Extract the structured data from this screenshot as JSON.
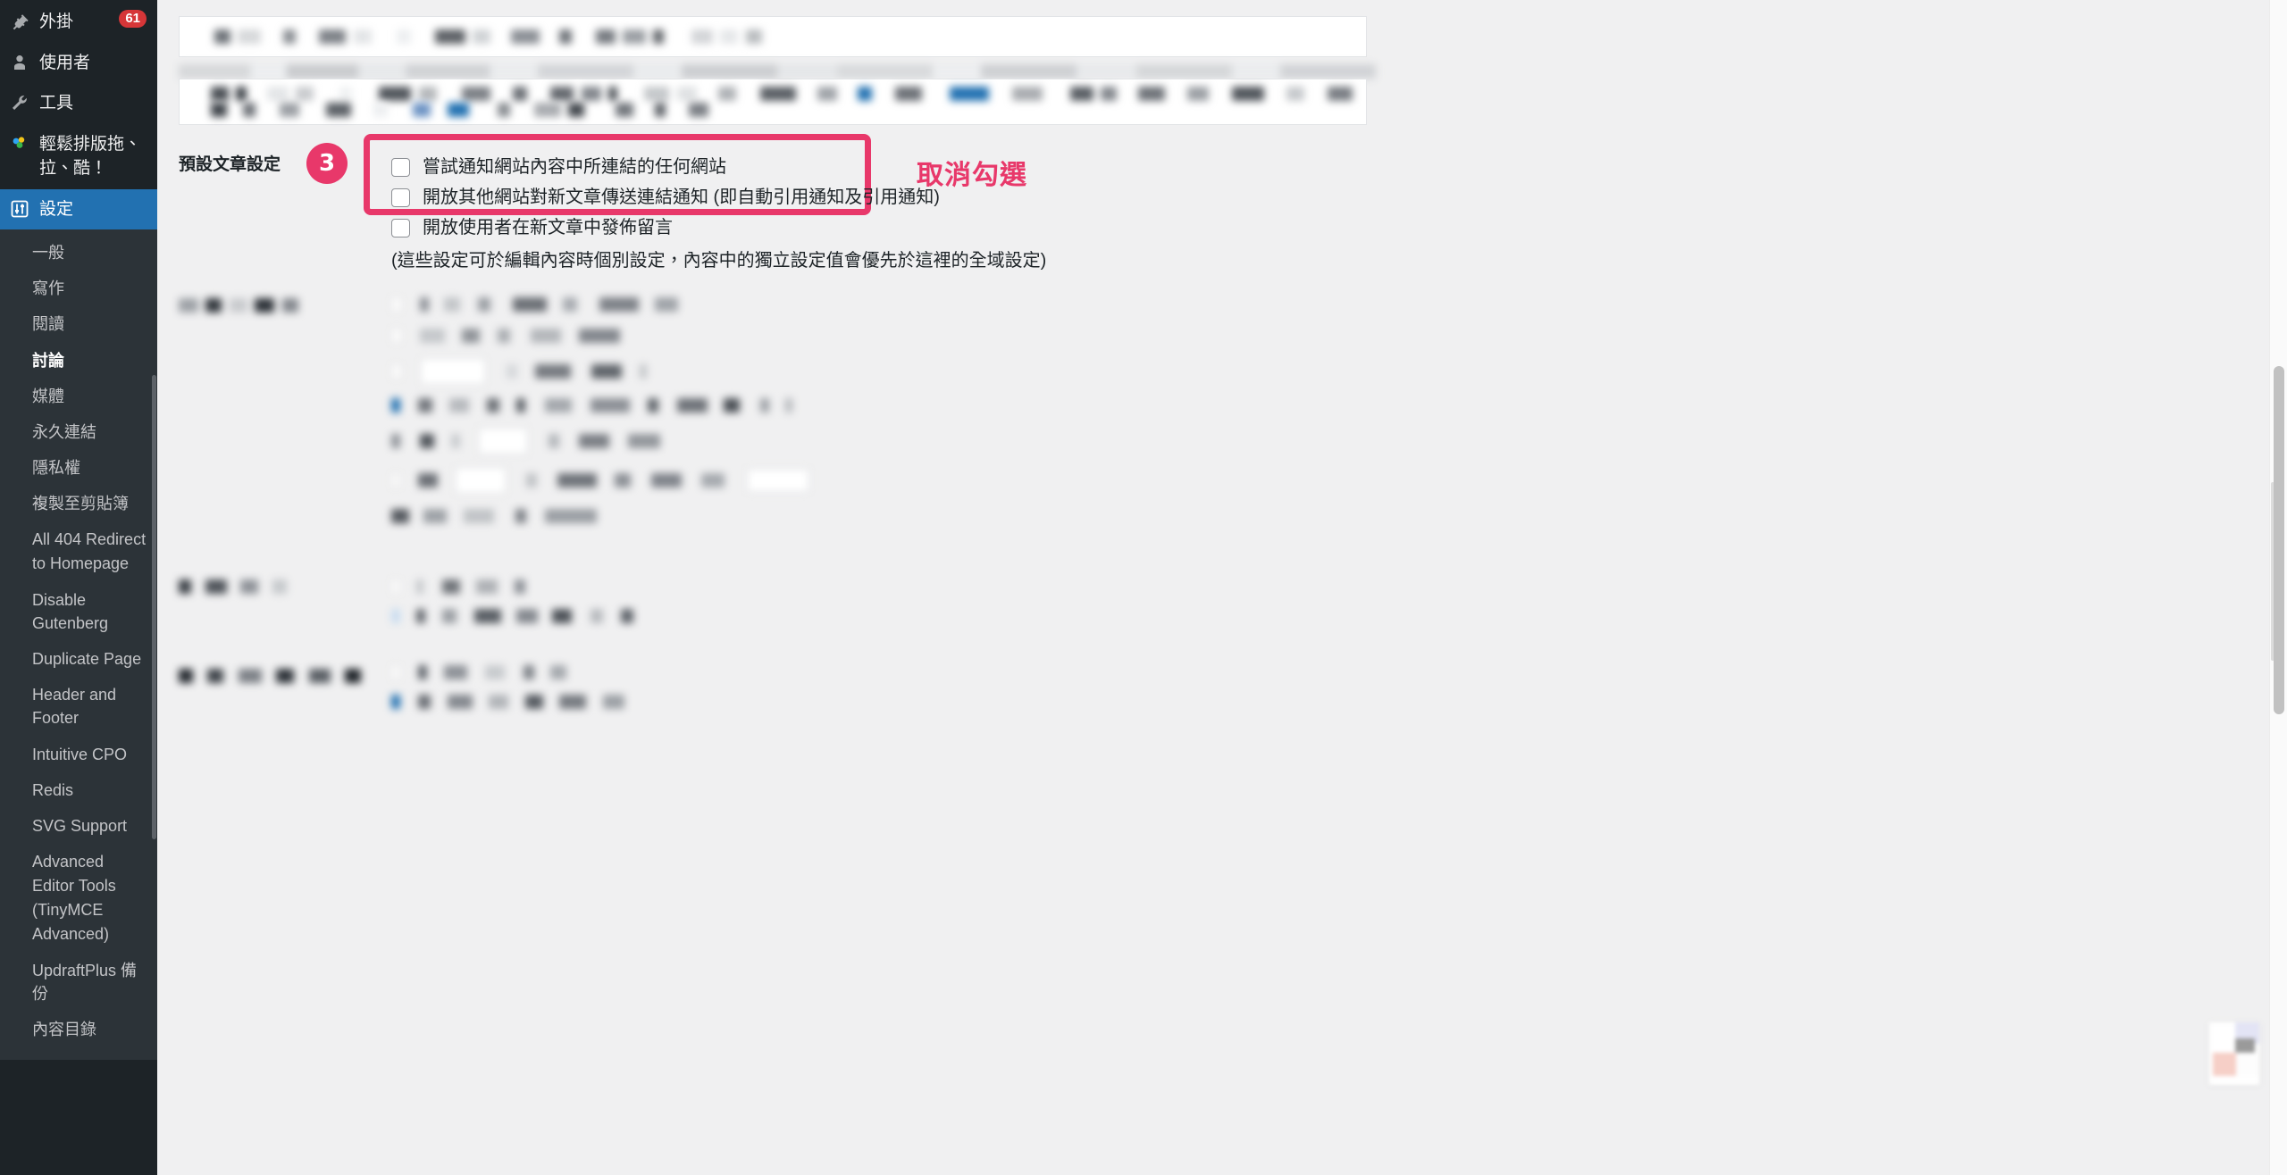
{
  "sidebar": {
    "menu": [
      {
        "label": "外掛",
        "icon": "plug-icon",
        "badge": "61",
        "current": false
      },
      {
        "label": "使用者",
        "icon": "user-icon",
        "badge": "",
        "current": false
      },
      {
        "label": "工具",
        "icon": "wrench-icon",
        "badge": "",
        "current": false
      },
      {
        "label": "輕鬆排版拖、拉、酷！",
        "icon": "puzzle-icon",
        "badge": "",
        "current": false
      },
      {
        "label": "設定",
        "icon": "settings-sliders-icon",
        "badge": "",
        "current": true
      }
    ],
    "submenu": [
      {
        "label": "一般",
        "current": false
      },
      {
        "label": "寫作",
        "current": false
      },
      {
        "label": "閱讀",
        "current": false
      },
      {
        "label": "討論",
        "current": true
      },
      {
        "label": "媒體",
        "current": false
      },
      {
        "label": "永久連結",
        "current": false
      },
      {
        "label": "隱私權",
        "current": false
      },
      {
        "label": "複製至剪貼簿",
        "current": false
      },
      {
        "label": "All 404 Redirect to Homepage",
        "current": false
      },
      {
        "label": "Disable Gutenberg",
        "current": false
      },
      {
        "label": "Duplicate Page",
        "current": false
      },
      {
        "label": "Header and Footer",
        "current": false
      },
      {
        "label": "Intuitive CPO",
        "current": false
      },
      {
        "label": "Redis",
        "current": false
      },
      {
        "label": "SVG Support",
        "current": false
      },
      {
        "label": "Advanced Editor Tools (TinyMCE Advanced)",
        "current": false
      },
      {
        "label": "UpdraftPlus 備份",
        "current": false
      },
      {
        "label": "內容目錄",
        "current": false
      }
    ]
  },
  "main": {
    "default_article_settings": {
      "row_label": "預設文章設定",
      "step_number": "3",
      "checkboxes": [
        {
          "label": "嘗試通知網站內容中所連結的任何網站",
          "checked": false,
          "highlighted": true
        },
        {
          "label": "開放其他網站對新文章傳送連結通知 (即自動引用通知及引用通知)",
          "checked": false,
          "highlighted": true
        },
        {
          "label": "開放使用者在新文章中發佈留言",
          "checked": false,
          "highlighted": false
        }
      ],
      "hint": "(這些設定可於編輯內容時個別設定，內容中的獨立設定值會優先於這裡的全域設定)"
    },
    "annotation": {
      "text": "取消勾選",
      "color": "#e8386a"
    }
  },
  "colors": {
    "accent_pink": "#e8386a",
    "admin_blue": "#2271b1",
    "sidebar_bg": "#1d2327",
    "submenu_bg": "#2c3338",
    "page_bg": "#f0f0f1"
  }
}
